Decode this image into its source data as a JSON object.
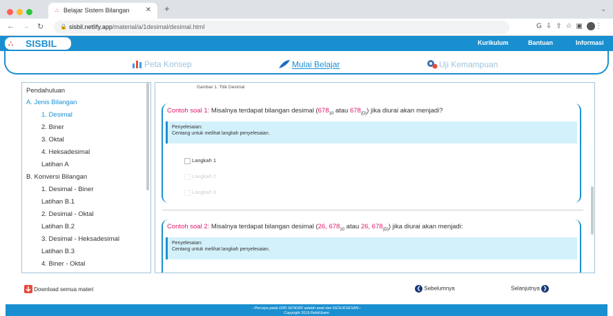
{
  "browser": {
    "tab_title": "Belajar Sistem Bilangan",
    "url_host": "sisbil.netlify.app",
    "url_path": "/material/a/1desimal/desimal.html"
  },
  "header": {
    "logo_text": "SISBIL",
    "links": [
      "Kurikulum",
      "Bantuan",
      "Informasi"
    ]
  },
  "menu": {
    "items": [
      "Peta Konsep",
      "Mulai Belajar",
      "Uji Kemampuan"
    ]
  },
  "sidebar": {
    "items": [
      {
        "label": "Pendahuluan"
      },
      {
        "label": "A. Jenis Bilangan"
      },
      {
        "label": "1. Desimal"
      },
      {
        "label": "2. Biner"
      },
      {
        "label": "3. Oktal"
      },
      {
        "label": "4. Heksadesimal"
      },
      {
        "label": "Latihan A"
      },
      {
        "label": "B. Konversi Bilangan"
      },
      {
        "label": "1. Desimal - Biner"
      },
      {
        "label": "Latihan B.1"
      },
      {
        "label": "2. Desimal - Oktal"
      },
      {
        "label": "Latihan B.2"
      },
      {
        "label": "3. Desimal - Heksadesimal"
      },
      {
        "label": "Latihan B.3"
      },
      {
        "label": "4. Biner - Oktal"
      }
    ]
  },
  "content": {
    "caption": "Gambar 1. Titik Desimal",
    "example1": {
      "label": "Contoh soal 1:",
      "text_a": " Misalnya terdapat bilangan desimal (",
      "num1": "678",
      "sub1": "10",
      "text_b": " atau ",
      "num2": "678",
      "sub2": "(D)",
      "text_c": ") jika diurai akan menjadi?",
      "solution_title": "Penyelesaian:",
      "solution_hint": "Centang untuk melihat langkah penyelesaian.",
      "steps": [
        "Langkah 1",
        "Langkah 2",
        "Langkah 3"
      ]
    },
    "example2": {
      "label": "Contoh soal 2:",
      "text_a": " Misalnya terdapat bilangan desimal (",
      "num1": "26, 678",
      "sub1": "10",
      "text_b": " atau ",
      "num2": "26, 678",
      "sub2": "(D)",
      "text_c": ") jika diurai akan menjadi:",
      "solution_title": "Penyelesaian:",
      "solution_hint": "Centang untuk melihat langkah penyelesaian."
    }
  },
  "bottom_nav": {
    "download": "Download semua materi",
    "prev": "Sebelumnya",
    "next": "Selanjutnya"
  },
  "footer": {
    "quote": "--Percaya pada DIRI SENDIRI adalah awal dari KESUKSESAN--",
    "copyright": "Copyright 2019 BektiUtami"
  },
  "colors": {
    "brand": "#1a8fd0",
    "highlight": "#e0176b",
    "solution_bg": "#d3f1fb"
  }
}
